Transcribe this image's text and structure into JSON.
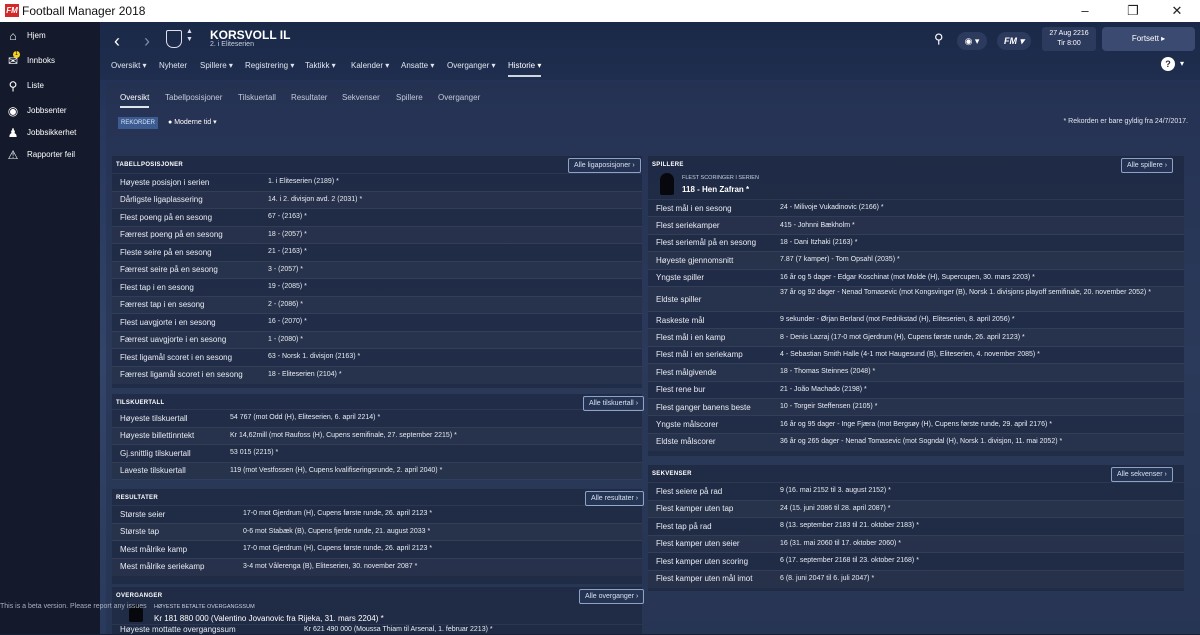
{
  "window": {
    "title": "Football Manager 2018",
    "logo": "FM",
    "controls": [
      "minimize-icon",
      "maximize-icon",
      "close-icon"
    ]
  },
  "sidebar": {
    "items": [
      {
        "label": "Hjem",
        "icon": "home-icon"
      },
      {
        "label": "Innboks",
        "icon": "inbox-icon",
        "badge": "1"
      },
      {
        "label": "Liste",
        "icon": "search-icon"
      },
      {
        "label": "Jobbsenter",
        "icon": "globe-icon"
      },
      {
        "label": "Jobbsikkerhet",
        "icon": "people-icon"
      },
      {
        "label": "Rapporter feil",
        "icon": "alert-icon"
      }
    ]
  },
  "header": {
    "club_name": "KORSVOLL IL",
    "club_sub": "2. i Eliteserien",
    "menu": [
      "Oversikt ▾",
      "Nyheter",
      "Spillere ▾",
      "Registrering ▾",
      "Taktikk ▾",
      "Kalender ▾",
      "Ansatte ▾",
      "Overganger ▾",
      "Historie ▾"
    ],
    "active_menu": "Historie ▾",
    "date_line1": "27 Aug 2216",
    "date_line2": "Tir 8:00",
    "continue_label": "Fortsett",
    "fm_label": "FM"
  },
  "subtabs": [
    "Oversikt",
    "Tabellposisjoner",
    "Tilskuertall",
    "Resultater",
    "Sekvenser",
    "Spillere",
    "Overganger"
  ],
  "filter": {
    "rekorder_label": "REKORDER",
    "time_label": "Moderne tid"
  },
  "note": "* Rekorden er bare gyldig fra 24/7/2017.",
  "tabellposisjoner": {
    "title": "TABELLPOSISJONER",
    "button": "Alle ligaposisjoner",
    "rows": [
      [
        "Høyeste posisjon i serien",
        "1. i Eliteserien (2189) *"
      ],
      [
        "Dårligste ligaplassering",
        "14. i 2. divisjon avd. 2 (2031) *"
      ],
      [
        "Flest poeng på en sesong",
        "67 - (2163) *"
      ],
      [
        "Færrest poeng på en sesong",
        "18 - (2057) *"
      ],
      [
        "Fleste seire på en sesong",
        "21 - (2163) *"
      ],
      [
        "Færrest seire på en sesong",
        "3 - (2057) *"
      ],
      [
        "Flest tap i en sesong",
        "19 - (2085) *"
      ],
      [
        "Færrest tap i en sesong",
        "2 - (2086) *"
      ],
      [
        "Flest uavgjorte i en sesong",
        "16 - (2070) *"
      ],
      [
        "Færrest uavgjorte i en sesong",
        "1 - (2080) *"
      ],
      [
        "Flest ligamål scoret i en sesong",
        "63 - Norsk 1. divisjon (2163) *"
      ],
      [
        "Færrest ligamål scoret i en sesong",
        "18 - Eliteserien (2104) *"
      ]
    ]
  },
  "tilskuertall": {
    "title": "TILSKUERTALL",
    "button": "Alle tilskuertall",
    "rows": [
      [
        "Høyeste tilskuertall",
        "54 767 (mot Odd (H), Eliteserien, 6. april 2214) *"
      ],
      [
        "Høyeste billettinntekt",
        "Kr 14,62mill (mot Raufoss (H), Cupens semifinale, 27. september 2215) *"
      ],
      [
        "Gj.snittlig tilskuertall",
        "53 015 (2215) *"
      ],
      [
        "Laveste tilskuertall",
        "119 (mot Vestfossen (H), Cupens kvalifiseringsrunde, 2. april 2040) *"
      ]
    ]
  },
  "resultater": {
    "title": "RESULTATER",
    "button": "Alle resultater",
    "rows": [
      [
        "Største seier",
        "17-0 mot Gjerdrum (H), Cupens første runde, 26. april 2123 *"
      ],
      [
        "Største tap",
        "0-6 mot Stabæk (B), Cupens fjerde runde, 21. august 2033 *"
      ],
      [
        "Mest målrike kamp",
        "17-0 mot Gjerdrum (H), Cupens første runde, 26. april 2123 *"
      ],
      [
        "Mest målrike seriekamp",
        "3-4 mot Vålerenga (B), Eliteserien, 30. november 2087 *"
      ]
    ]
  },
  "overganger": {
    "title": "OVERGANGER",
    "button": "Alle overganger",
    "highest_paid_label": "HØYESTE BETALTE OVERGANGSSUM",
    "highest_paid_value": "Kr 181 880 000 (Valentino Jovanovic fra Rijeka, 31. mars 2204) *",
    "rows": [
      [
        "Høyeste mottatte overgangssum",
        "Kr 621 490 000 (Moussa Thiam til Arsenal, 1. februar 2213) *"
      ]
    ]
  },
  "spillere": {
    "title": "SPILLERE",
    "button": "Alle spillere",
    "top_scorer_label": "FLEST SCORINGER I SERIEN",
    "top_scorer_value": "118 - Hen Zafran *",
    "rows": [
      [
        "Flest mål i en sesong",
        "24 - Milivoje Vukadinovic (2166) *"
      ],
      [
        "Flest seriekamper",
        "415 - Johnni Bækholm *"
      ],
      [
        "Flest seriemål på en sesong",
        "18 - Dani Itzhaki (2163) *"
      ],
      [
        "Høyeste gjennomsnitt",
        "7.87 (7 kamper) - Tom Opsahl (2035) *"
      ],
      [
        "Yngste spiller",
        "16 år og 5 dager - Edgar Koschinat (mot Molde (H), Supercupen, 30. mars 2203) *"
      ],
      [
        "Eldste spiller",
        "37 år og 92 dager - Nenad Tomasevic (mot Kongsvinger (B), Norsk 1. divisjons playoff semifinale, 20. november 2052) *"
      ],
      [
        "Raskeste mål",
        "9 sekunder - Ørjan Berland (mot Fredrikstad (H), Eliteserien, 8. april 2056) *"
      ],
      [
        "Flest mål i en kamp",
        "8 - Denis Lazraj (17-0 mot Gjerdrum (H), Cupens første runde, 26. april 2123) *"
      ],
      [
        "Flest mål i en seriekamp",
        "4 - Sebastian Smith Halle (4-1 mot Haugesund (B), Eliteserien, 4. november 2085) *"
      ],
      [
        "Flest målgivende",
        "18 - Thomas Steinnes (2048) *"
      ],
      [
        "Flest rene bur",
        "21 - João Machado (2198) *"
      ],
      [
        "Flest ganger banens beste",
        "10 - Torgeir Steffensen (2105) *"
      ],
      [
        "Yngste målscorer",
        "16 år og 95 dager - Inge Fjæra (mot Bergsøy (H), Cupens første runde, 29. april 2176) *"
      ],
      [
        "Eldste målscorer",
        "36 år og 265 dager - Nenad Tomasevic (mot Sogndal (H), Norsk 1. divisjon, 11. mai 2052) *"
      ]
    ]
  },
  "sekvenser": {
    "title": "SEKVENSER",
    "button": "Alle sekvenser",
    "rows": [
      [
        "Flest seiere på rad",
        "9 (16. mai 2152 til 3. august 2152) *"
      ],
      [
        "Flest kamper uten tap",
        "24 (15. juni 2086 til 28. april 2087) *"
      ],
      [
        "Flest tap på rad",
        "8 (13. september 2183 til 21. oktober 2183) *"
      ],
      [
        "Flest kamper uten seier",
        "16 (31. mai 2060 til 17. oktober 2060) *"
      ],
      [
        "Flest kamper uten scoring",
        "6 (17. september 2168 til 23. oktober 2168) *"
      ],
      [
        "Flest kamper uten mål imot",
        "6 (8. juni 2047 til 6. juli 2047) *"
      ]
    ]
  },
  "beta_note": "This is a beta version. Please report any issues"
}
